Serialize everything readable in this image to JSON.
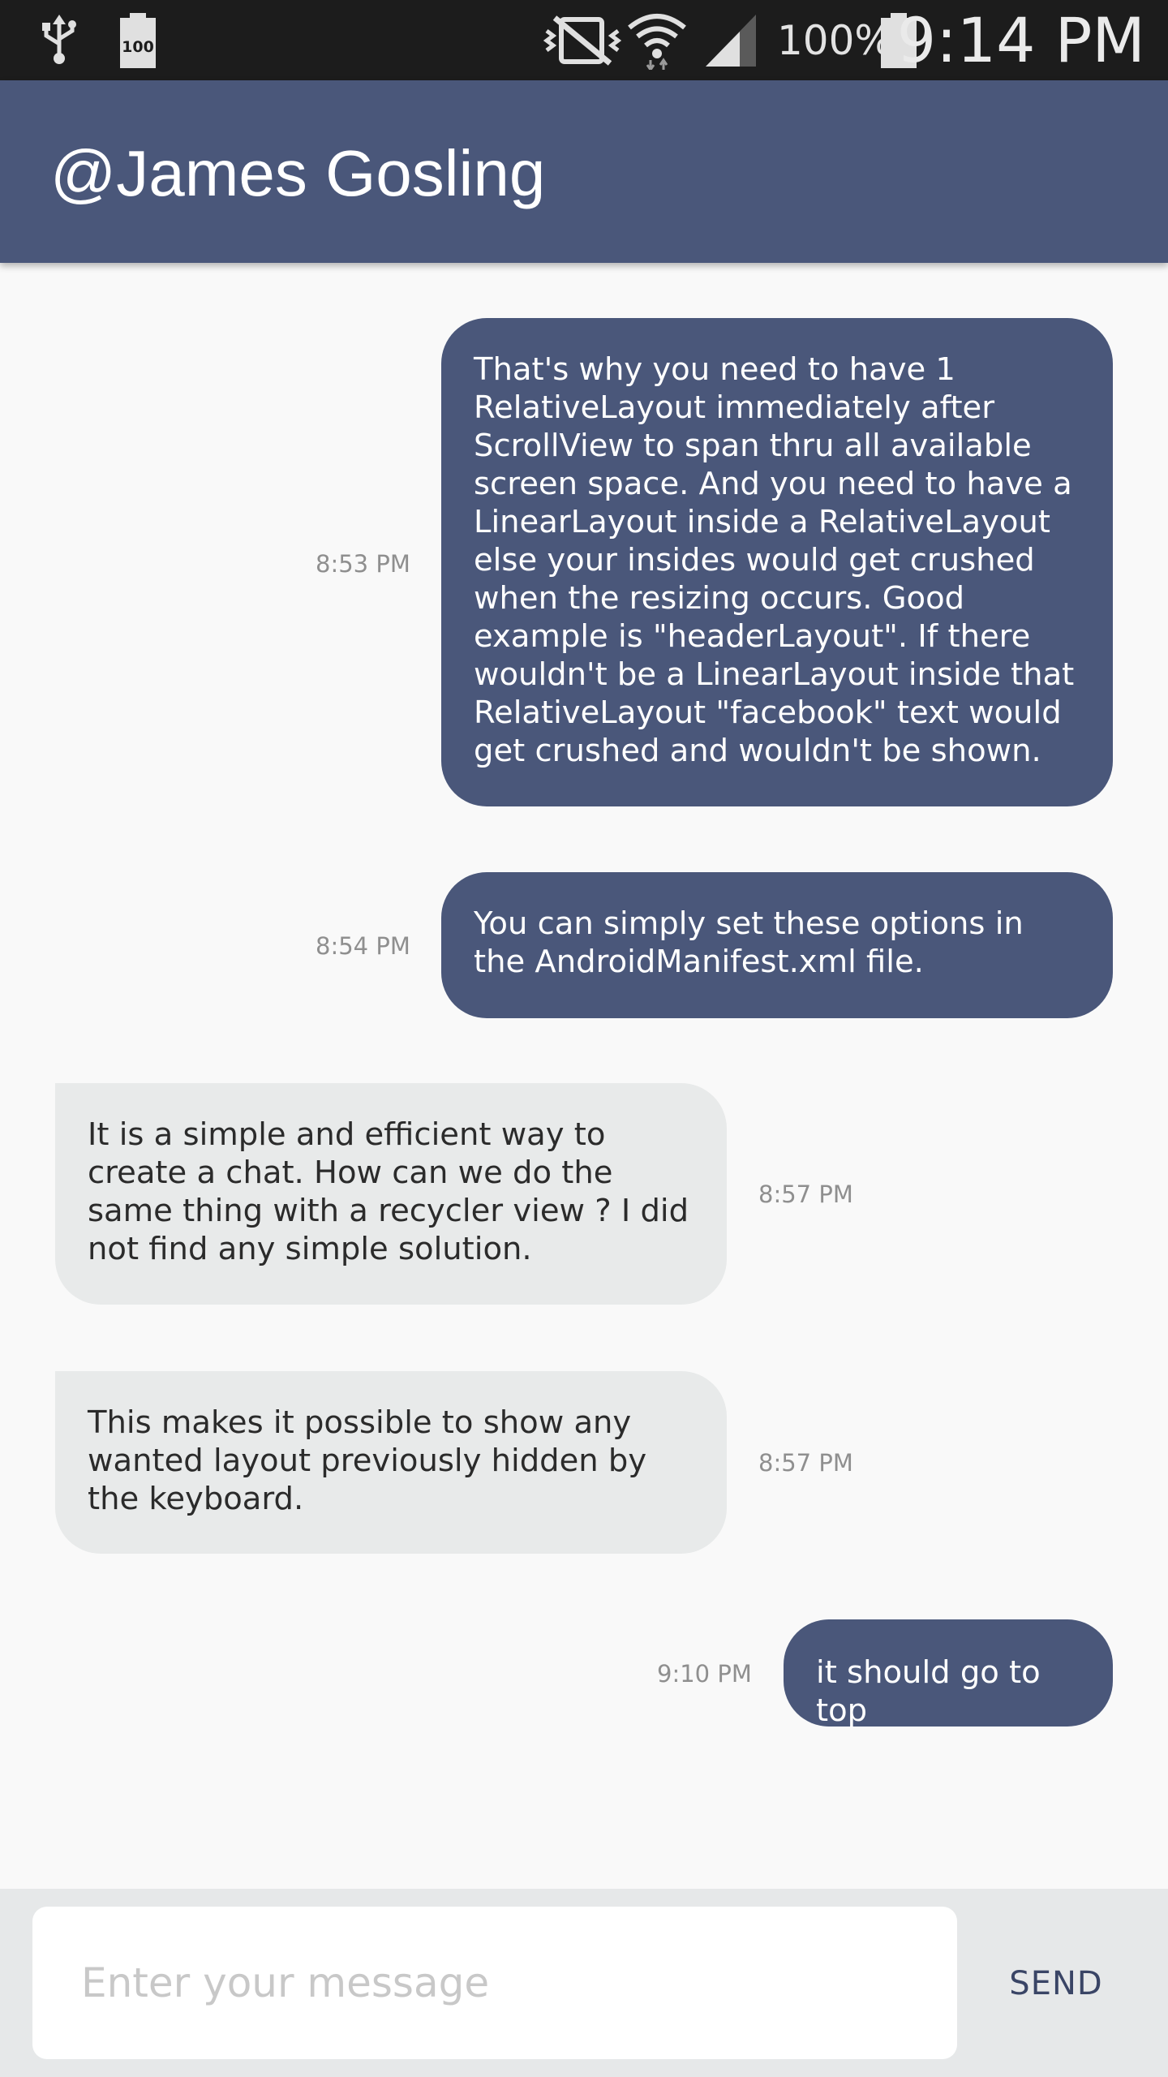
{
  "status_bar": {
    "battery_saver_label": "100",
    "battery_percent": "100%",
    "time": "9:14 PM",
    "icons": [
      "usb-icon",
      "battery-saver-icon",
      "vibrate-icon",
      "wifi-icon",
      "signal-icon",
      "battery-icon"
    ]
  },
  "header": {
    "title": "@James Gosling",
    "color": "#4a577a"
  },
  "messages": [
    {
      "direction": "outgoing",
      "text": "That's why you need to have 1 RelativeLayout immediately after ScrollView to span thru all available screen space. And you need to have a LinearLayout inside a RelativeLayout else your insides would get crushed when the resizing occurs. Good example is \"headerLayout\". If there wouldn't be a LinearLayout inside that RelativeLayout \"facebook\" text would get crushed and wouldn't be shown.",
      "time": "8:53 PM"
    },
    {
      "direction": "outgoing",
      "text": "You can simply set these options in the AndroidManifest.xml file.",
      "time": "8:54 PM"
    },
    {
      "direction": "incoming",
      "text": "It is a simple and efficient way to create a chat. How can we do the same thing with a recycler view ? I did not find any simple solution.",
      "time": "8:57 PM"
    },
    {
      "direction": "incoming",
      "text": "This makes it possible to show any wanted layout previously hidden by the keyboard.",
      "time": "8:57 PM"
    },
    {
      "direction": "outgoing",
      "text": "it should go to top",
      "time": "9:10 PM"
    }
  ],
  "composer": {
    "placeholder": "Enter your message",
    "value": "",
    "send_label": "SEND"
  },
  "colors": {
    "outgoing_bubble": "#4a577a",
    "incoming_bubble": "#e8eaea",
    "background": "#f9f9f9"
  }
}
